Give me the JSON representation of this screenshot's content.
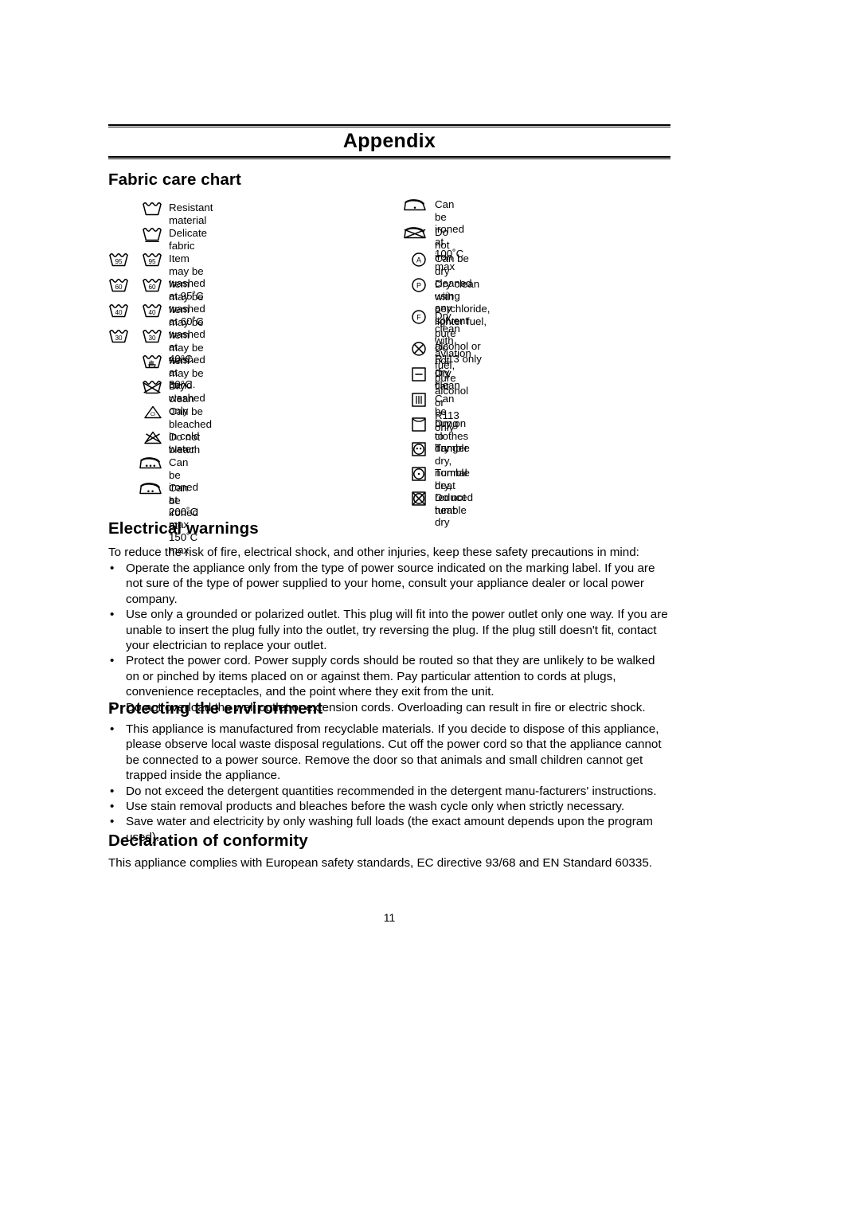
{
  "header": {
    "title": "Appendix"
  },
  "sections": {
    "fabric_care": {
      "heading": "Fabric care chart"
    },
    "electrical": {
      "heading": "Electrical warnings",
      "intro": "To reduce the risk of fire, electrical shock, and other injuries, keep these safety precautions in mind:",
      "bullets": [
        "Operate the appliance only from the type of power source indicated on the marking label.  If you are not sure of the type of power supplied to your home, consult your appliance dealer or local power company.",
        "Use only a grounded or polarized outlet. This plug will fit into the power outlet only one way.  If you are unable to insert the plug fully into the outlet, try reversing the plug.  If the plug still doesn't fit, contact your electrician to replace your outlet.",
        "Protect the power cord. Power supply cords should be routed so that they are unlikely to be walked on or pinched by items placed on or against them.  Pay particular attention to cords at plugs, convenience receptacles, and the point where they exit from the unit.",
        "Do not overload the wall outlet or extension cords.  Overloading can result in fire or electric shock."
      ]
    },
    "environment": {
      "heading": "Protecting the environment",
      "bullets": [
        "This appliance is manufactured from recyclable materials. If you decide to dispose of this appliance, please observe local waste disposal regulations.  Cut off the power cord so that the appliance cannot be connected to a power source.  Remove the door so that animals and small children cannot get trapped inside the appliance.",
        "Do not exceed the detergent quantities recommended in the detergent manu-facturers' instructions.",
        "Use stain removal products and bleaches before the wash cycle only when strictly necessary.",
        "Save water and electricity by only washing full loads (the exact amount depends upon the program used)."
      ]
    },
    "conformity": {
      "heading": "Declaration of conformity",
      "text": "This appliance complies with European safety standards, EC directive 93/68 and EN Standard 60335."
    }
  },
  "care_chart": {
    "left": [
      {
        "icon": "wash-tub-icon",
        "label": "Resistant material",
        "temp": ""
      },
      {
        "icon": "wash-tub-underline-icon",
        "label": "Delicate fabric",
        "temp": ""
      },
      {
        "icon": "wash-tub-pair-icon",
        "label": "Item may be washed at 95˚C",
        "temp": "95"
      },
      {
        "icon": "wash-tub-pair-icon",
        "label": "Item may be washed at 60˚C",
        "temp": "60"
      },
      {
        "icon": "wash-tub-pair-icon",
        "label": "Item may be washed at 40°C.",
        "temp": "40"
      },
      {
        "icon": "wash-tub-pair-icon",
        "label": "Item may be washed at 30°C.",
        "temp": "30"
      },
      {
        "icon": "hand-wash-icon",
        "label": "Item may be hand washed",
        "temp": ""
      },
      {
        "icon": "dry-clean-only-icon",
        "label": "Dry clean only",
        "temp": ""
      },
      {
        "icon": "bleach-cold-water-icon",
        "label": "Can be bleached in cold water",
        "temp": "Cl"
      },
      {
        "icon": "do-not-bleach-icon",
        "label": "Do not bleach",
        "temp": ""
      },
      {
        "icon": "iron-three-dots-icon",
        "label": "Can be ironed at 200˚C max",
        "temp": ""
      },
      {
        "icon": "iron-two-dots-icon",
        "label": "Can be ironed at 150˚C max",
        "temp": ""
      }
    ],
    "right": [
      {
        "icon": "iron-one-dot-icon",
        "label": "Can be ironed at 100˚C  max"
      },
      {
        "icon": "do-not-iron-icon",
        "label": "Do not iron"
      },
      {
        "icon": "dry-clean-any-solvent-icon",
        "label": "Can be dry cleaned using any solvent",
        "letter": "A"
      },
      {
        "icon": "dry-clean-perchloride-icon",
        "label": "Dry clean with perchloride, lighter fuel,\npure alcohol or R113 only",
        "letter": "P"
      },
      {
        "icon": "dry-clean-aviation-fuel-icon",
        "label": "Dry clean with aviation fuel, pure alcohol or\nR113 only",
        "letter": "F"
      },
      {
        "icon": "do-not-dry-clean-icon",
        "label": "Do not dry clean"
      },
      {
        "icon": "dry-flat-icon",
        "label": "Dry flat"
      },
      {
        "icon": "hang-to-dry-icon",
        "label": "Can be hung to dry"
      },
      {
        "icon": "drip-dry-hanger-icon",
        "label": "Dry on clothes hanger"
      },
      {
        "icon": "tumble-dry-normal-icon",
        "label": "Tumble dry, normal heat"
      },
      {
        "icon": "tumble-dry-reduced-icon",
        "label": "Tumble dry, reduced heat"
      },
      {
        "icon": "do-not-tumble-dry-icon",
        "label": "Do not tumble dry"
      }
    ]
  },
  "footer": {
    "page_number": "11"
  }
}
